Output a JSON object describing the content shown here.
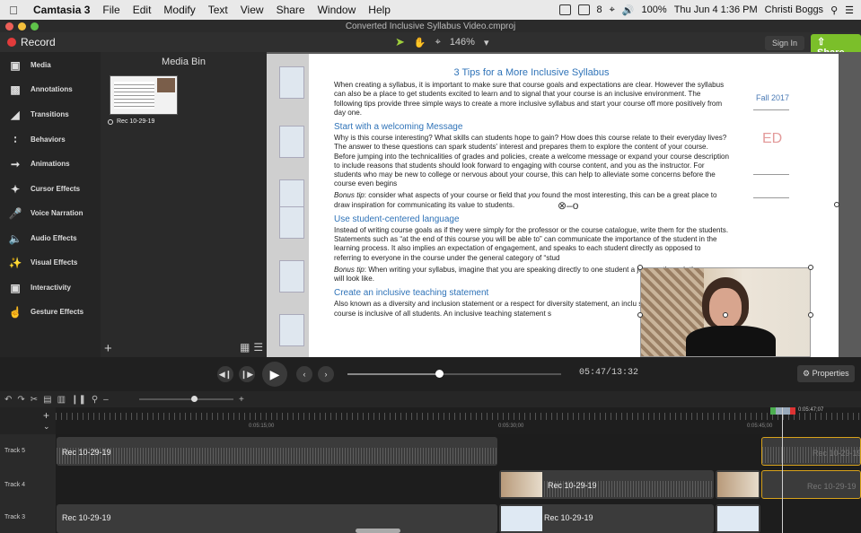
{
  "menubar": {
    "app": "Camtasia 3",
    "items": [
      "File",
      "Edit",
      "Modify",
      "Text",
      "View",
      "Share",
      "Window",
      "Help"
    ],
    "battery": "100%",
    "datetime": "Thu Jun 4  1:36 PM",
    "user": "Christi Boggs",
    "badge": "8"
  },
  "window": {
    "title": "Converted Inclusive Syllabus Video.cmproj"
  },
  "toolbar": {
    "record": "Record",
    "zoom": "146%",
    "signin": "Sign In",
    "share": "Share"
  },
  "sidebar": {
    "items": [
      {
        "label": "Media",
        "icon": "film-icon"
      },
      {
        "label": "Annotations",
        "icon": "annotation-icon"
      },
      {
        "label": "Transitions",
        "icon": "transition-icon"
      },
      {
        "label": "Behaviors",
        "icon": "behavior-icon"
      },
      {
        "label": "Animations",
        "icon": "animation-icon"
      },
      {
        "label": "Cursor Effects",
        "icon": "cursor-icon"
      },
      {
        "label": "Voice Narration",
        "icon": "mic-icon"
      },
      {
        "label": "Audio Effects",
        "icon": "speaker-icon"
      },
      {
        "label": "Visual Effects",
        "icon": "wand-icon"
      },
      {
        "label": "Interactivity",
        "icon": "interactive-icon"
      },
      {
        "label": "Gesture Effects",
        "icon": "hand-icon"
      }
    ]
  },
  "mediabin": {
    "title": "Media Bin",
    "clip_label": "Rec 10-29-19"
  },
  "document": {
    "title": "3 Tips for a More Inclusive Syllabus",
    "intro": "When creating a syllabus, it is important to make sure that course goals and expectations are clear. However the syllabus can also be a place to get students excited to learn and to signal that your course is an inclusive environment. The following tips provide three simple ways to create a more inclusive syllabus and start your course off more positively from day one.",
    "h1": "Start with a welcoming Message",
    "p1": "Why is this course interesting? What skills can students hope to gain? How does this course relate to their everyday lives? The answer to these questions can spark students' interest and prepares them to explore the content of your course. Before jumping into the technicalities of grades and policies, create a welcome message or expand your course description to include reasons that students should look forward to engaging with course content, and you as the instructor. For students who may be new to college or nervous about your course, this can help to alleviate some concerns before the course even begins",
    "tip1_label": "Bonus tip",
    "tip1_a": ": consider what aspects of your course or field that ",
    "tip1_you": "you",
    "tip1_b": " found the most interesting, this can be a great place to draw inspiration for communicating its value to students.",
    "h2": "Use student-centered language",
    "p2": "Instead of writing course goals as if they were simply for the professor or the course catalogue, write them for the students. Statements such as “at the end of this course you will be able to” can communicate the importance of the student in the learning process. It also implies an expectation of engagement, and speaks to each student directly as opposed to referring to everyone in the course under the general category of “stud",
    "tip2_label": "Bonus tip",
    "tip2": ": When writing your syllabus, imagine that you are speaking directly to one student a journey through the course will look like.",
    "h3": "Create an inclusive teaching statement",
    "p3": "Also known as a diversity and inclusion statement or a respect for diversity statement, an inclu signals explicitly that your course is inclusive of all students. An inclusive teaching statement s"
  },
  "rightdoc": {
    "fall": "Fall 2017",
    "ed": "ED"
  },
  "playback": {
    "time": "05:47/13:32",
    "progress": 0.43,
    "properties": "Properties"
  },
  "ruler": {
    "labels": [
      "0:05:15;00",
      "0:05:30;00",
      "0:05:45;00",
      "0:05:47;07"
    ]
  },
  "tracks": [
    {
      "name": "Track 5",
      "clips": [
        "Rec 10-29-19",
        "Rec 10-29-19"
      ]
    },
    {
      "name": "Track 4",
      "clips": [
        "Rec 10-29-19",
        "Rec 10-29-19"
      ]
    },
    {
      "name": "Track 3",
      "clips": [
        "Rec 10-29-19",
        "Rec 10-29-19"
      ]
    }
  ],
  "colors": {
    "accent": "#7bbf2a",
    "record": "#e23b3b",
    "link": "#2f73b8",
    "selected": "#d8a21b"
  }
}
